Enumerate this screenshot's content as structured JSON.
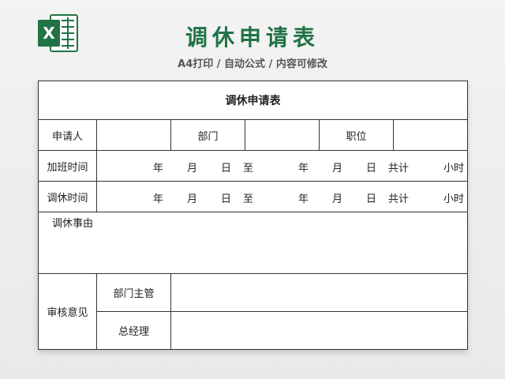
{
  "header": {
    "title": "调休申请表",
    "subtitle": "A4打印 / 自动公式 / 内容可修改",
    "logo_icon": "excel-icon",
    "brand_color": "#217346"
  },
  "form": {
    "title": "调休申请表",
    "row1": {
      "applicant_label": "申请人",
      "department_label": "部门",
      "position_label": "职位"
    },
    "overtime": {
      "label": "加班时间",
      "year": "年",
      "month": "月",
      "day": "日",
      "to": "至",
      "year2": "年",
      "month2": "月",
      "day2": "日",
      "total": "共计",
      "hours": "小时"
    },
    "leave": {
      "label": "调休时间",
      "year": "年",
      "month": "月",
      "day": "日",
      "to": "至",
      "year2": "年",
      "month2": "月",
      "day2": "日",
      "total": "共计",
      "hours": "小时"
    },
    "reason_label": "调休事由",
    "review": {
      "label": "审核意见",
      "dept_head_label": "部门主管",
      "gm_label": "总经理"
    }
  }
}
